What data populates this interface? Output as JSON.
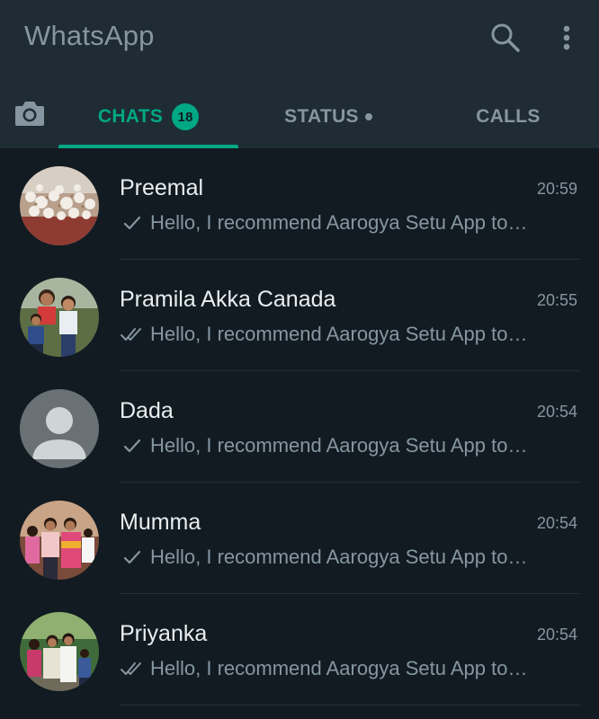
{
  "header": {
    "title": "WhatsApp",
    "search_icon": "search-icon",
    "menu_icon": "more-vertical-icon"
  },
  "tabs": {
    "camera_icon": "camera-icon",
    "chats": {
      "label": "CHATS",
      "badge": "18"
    },
    "status": {
      "label": "STATUS"
    },
    "calls": {
      "label": "CALLS"
    },
    "active": "CHATS"
  },
  "colors": {
    "accent": "#00a884",
    "background": "#121b22",
    "header": "#1f2c34",
    "text_primary": "#e9edef",
    "text_secondary": "#8696a0"
  },
  "chats": [
    {
      "name": "Preemal",
      "time": "20:59",
      "tick": "single",
      "preview": "Hello, I recommend Aarogya Setu App to…"
    },
    {
      "name": "Pramila Akka Canada",
      "time": "20:55",
      "tick": "double",
      "preview": "Hello, I recommend Aarogya Setu App to…"
    },
    {
      "name": "Dada",
      "time": "20:54",
      "tick": "single",
      "preview": "Hello, I recommend Aarogya Setu App to…"
    },
    {
      "name": "Mumma",
      "time": "20:54",
      "tick": "single",
      "preview": "Hello, I recommend Aarogya Setu App to…"
    },
    {
      "name": "Priyanka",
      "time": "20:54",
      "tick": "double",
      "preview": "Hello, I recommend Aarogya Setu App to…"
    }
  ]
}
